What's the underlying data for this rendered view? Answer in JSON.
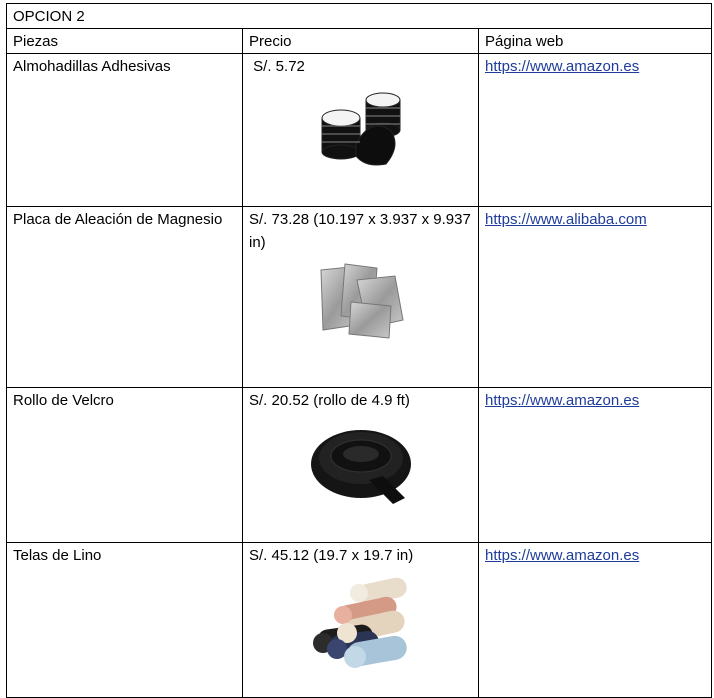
{
  "table": {
    "title": "OPCION 2",
    "headers": [
      "Piezas",
      "Precio",
      "Página web"
    ],
    "rows": [
      {
        "pieza": "Almohadillas Adhesivas",
        "precio": " S/. 5.72",
        "web": "https://www.amazon.es",
        "image": "adhesive-pads-photo"
      },
      {
        "pieza": "Placa de Aleación de Magnesio",
        "precio": "S/. 73.28 (10.197 x 3.937 x 9.937 in)",
        "web": "https://www.alibaba.com",
        "image": "magnesium-plates-photo"
      },
      {
        "pieza": "Rollo de Velcro",
        "precio": "S/. 20.52 (rollo de 4.9 ft)",
        "web": "https://www.amazon.es",
        "image": "velcro-roll-photo"
      },
      {
        "pieza": "Telas de Lino",
        "precio": "S/. 45.12 (19.7 x 19.7 in)",
        "web": "https://www.amazon.es",
        "image": "linen-fabric-rolls-photo"
      }
    ]
  }
}
